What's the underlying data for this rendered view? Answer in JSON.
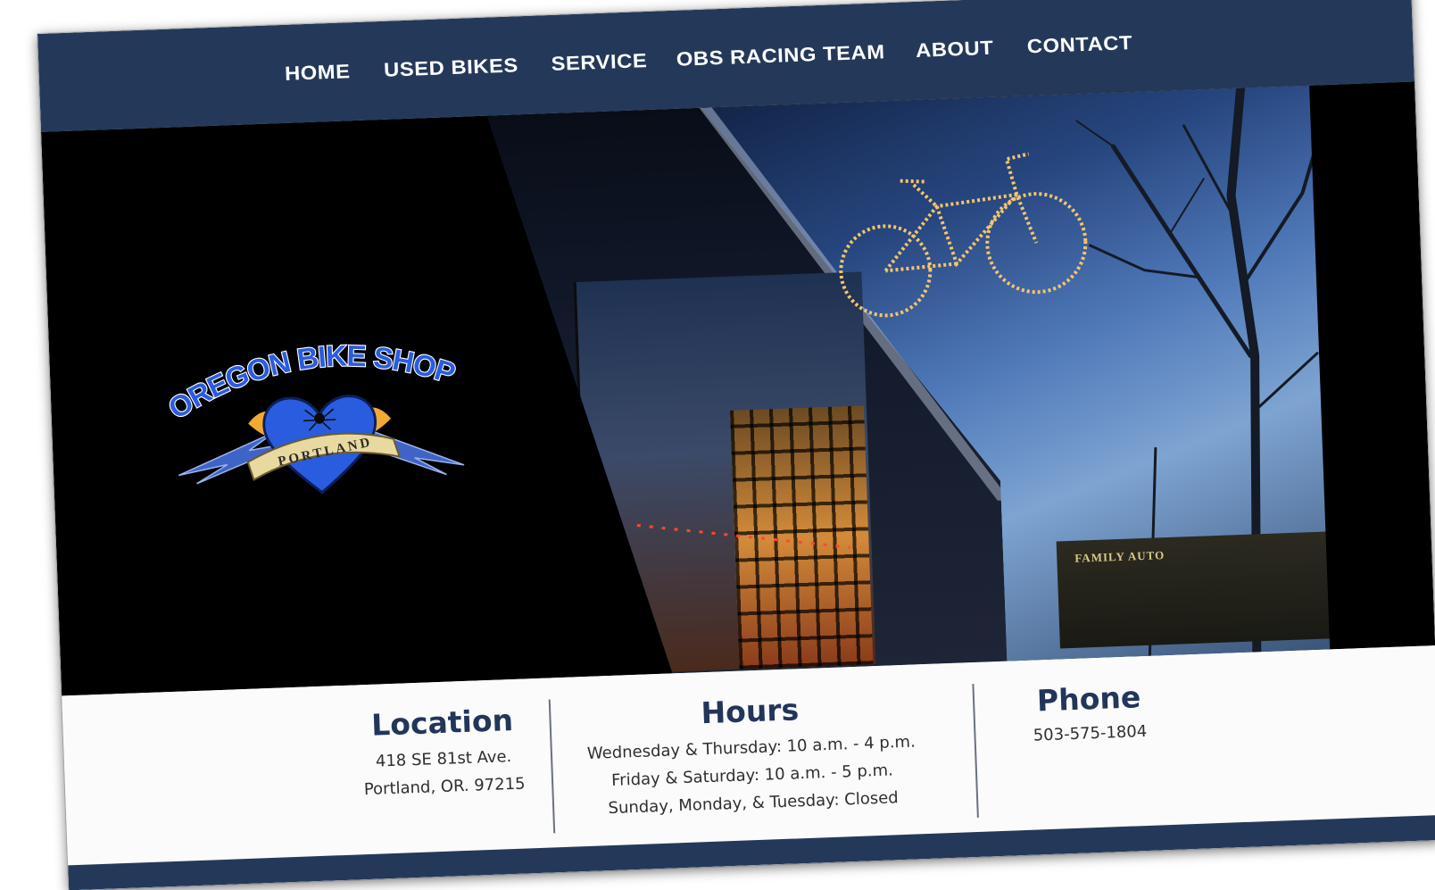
{
  "nav": {
    "items": [
      "Home",
      "Used Bikes",
      "Service",
      "OBS Racing Team",
      "About",
      "Contact"
    ]
  },
  "hero": {
    "logo": {
      "name": "OREGON BIKE SHOP",
      "ribbon": "PORTLAND"
    },
    "photo_sign": "FAMILY AUTO"
  },
  "info": {
    "location": {
      "title": "Location",
      "line1": "418 SE 81st Ave.",
      "line2": "Portland, OR. 97215"
    },
    "hours": {
      "title": "Hours",
      "line1": "Wednesday & Thursday: 10 a.m. - 4 p.m.",
      "line2": "Friday & Saturday: 10 a.m. - 5 p.m.",
      "line3": "Sunday, Monday, & Tuesday: Closed"
    },
    "phone": {
      "title": "Phone",
      "number": "503-575-1804"
    }
  },
  "colors": {
    "nav_bg": "#24395a",
    "heading": "#22365a",
    "logo_blue": "#1f4fd8",
    "ribbon": "#e8d9a0"
  }
}
